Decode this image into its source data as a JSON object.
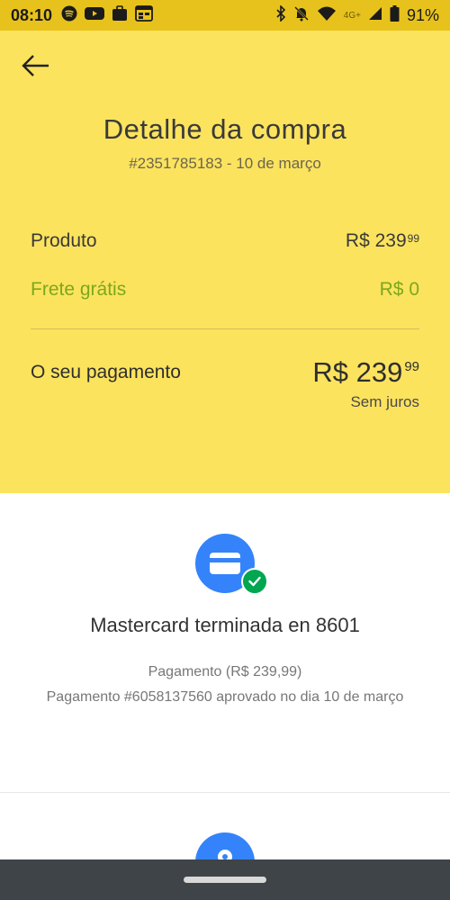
{
  "status_bar": {
    "time": "08:10",
    "left_icons": [
      "spotify-icon",
      "youtube-icon",
      "briefcase-icon",
      "calendar-icon"
    ],
    "right_icons": [
      "bluetooth-icon",
      "alarm-off-icon",
      "wifi-icon",
      "signal-icon",
      "battery-icon"
    ],
    "network": "4G+",
    "battery": "91%"
  },
  "header": {
    "back_icon": "arrow-left-icon",
    "title": "Detalhe da compra",
    "subtitle": "#2351785183 - 10 de março",
    "background_color": "#fce35e"
  },
  "summary": {
    "product_label": "Produto",
    "product_value_main": "R$ 239",
    "product_value_cents": "99",
    "shipping_label": "Frete grátis",
    "shipping_value": "R$ 0",
    "shipping_color": "#7ca81b",
    "payment_label": "O seu pagamento",
    "payment_value_main": "R$ 239",
    "payment_value_cents": "99",
    "payment_note": "Sem juros"
  },
  "payment_method": {
    "icon": "credit-card-icon",
    "status_icon": "check-icon",
    "title": "Mastercard terminada en 8601",
    "detail_line1": "Pagamento (R$ 239,99)",
    "detail_line2": "Pagamento #6058137560 aprovado no dia 10 de março",
    "icon_color": "#3483fa",
    "status_color": "#00a650"
  },
  "next_section": {
    "icon": "location-pin-icon"
  }
}
